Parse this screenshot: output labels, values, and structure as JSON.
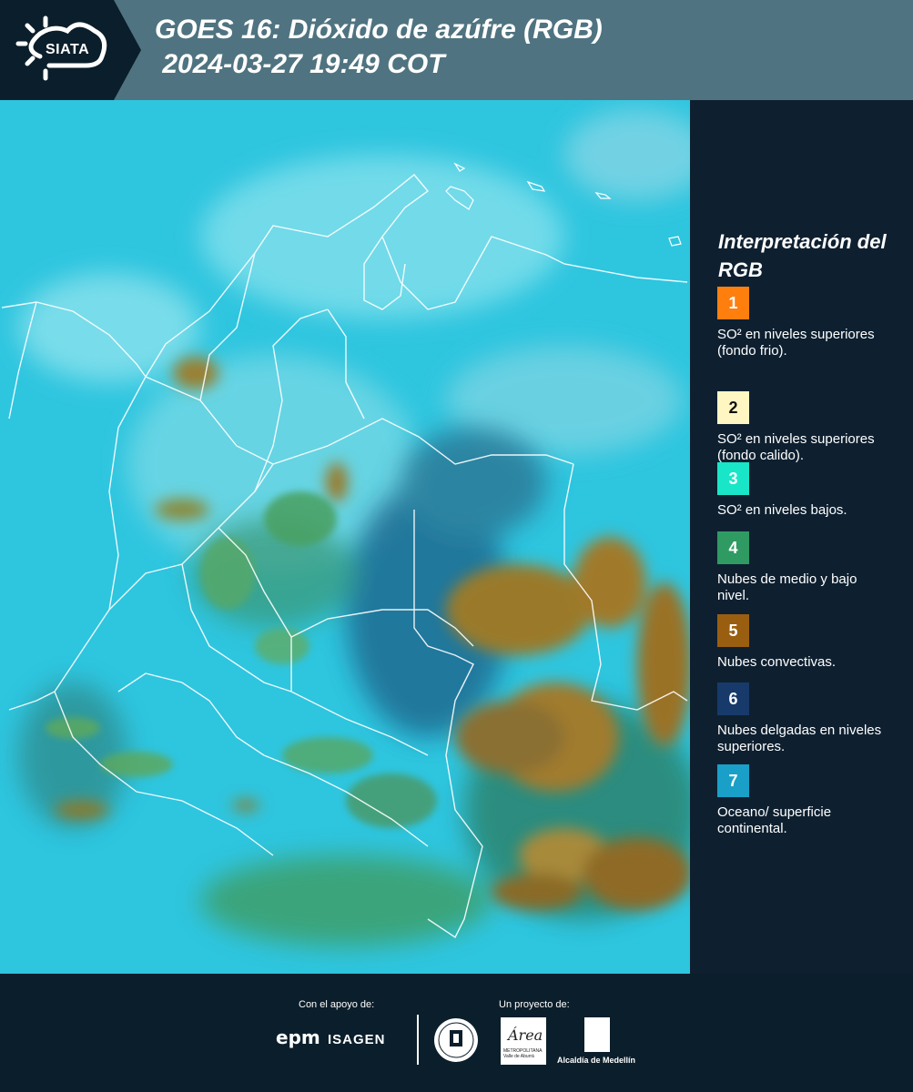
{
  "header": {
    "logo_text": "SIATA",
    "title": "GOES 16: Dióxido de azúfre (RGB)\n 2024-03-27 19:49 COT"
  },
  "legend": {
    "title": "Interpretación del RGB",
    "items": [
      {
        "number": "1",
        "color": "#ff7f0e",
        "text": "SO² en niveles superiores (fondo frio)."
      },
      {
        "number": "2",
        "color": "#fff6c2",
        "text": "SO² en niveles superiores (fondo calido)."
      },
      {
        "number": "3",
        "color": "#19e6c8",
        "text": "SO² en niveles bajos."
      },
      {
        "number": "4",
        "color": "#2f9a62",
        "text": "Nubes de medio y bajo nivel."
      },
      {
        "number": "5",
        "color": "#9a5e10",
        "text": "Nubes convectivas."
      },
      {
        "number": "6",
        "color": "#173a6a",
        "text": "Nubes delgadas en niveles superiores."
      },
      {
        "number": "7",
        "color": "#1aa0c8",
        "text": "Oceano/ superficie continental."
      }
    ]
  },
  "footer": {
    "support_label": "Con el apoyo de:",
    "project_label": "Un proyecto de:",
    "sponsors": [
      "epm",
      "ISAGEN"
    ],
    "area_logo_text": "Área",
    "area_logo_subtext": "METROPOLITANA Valle de Aburrá",
    "alcaldia_label": "Alcaldía de Medellín"
  }
}
